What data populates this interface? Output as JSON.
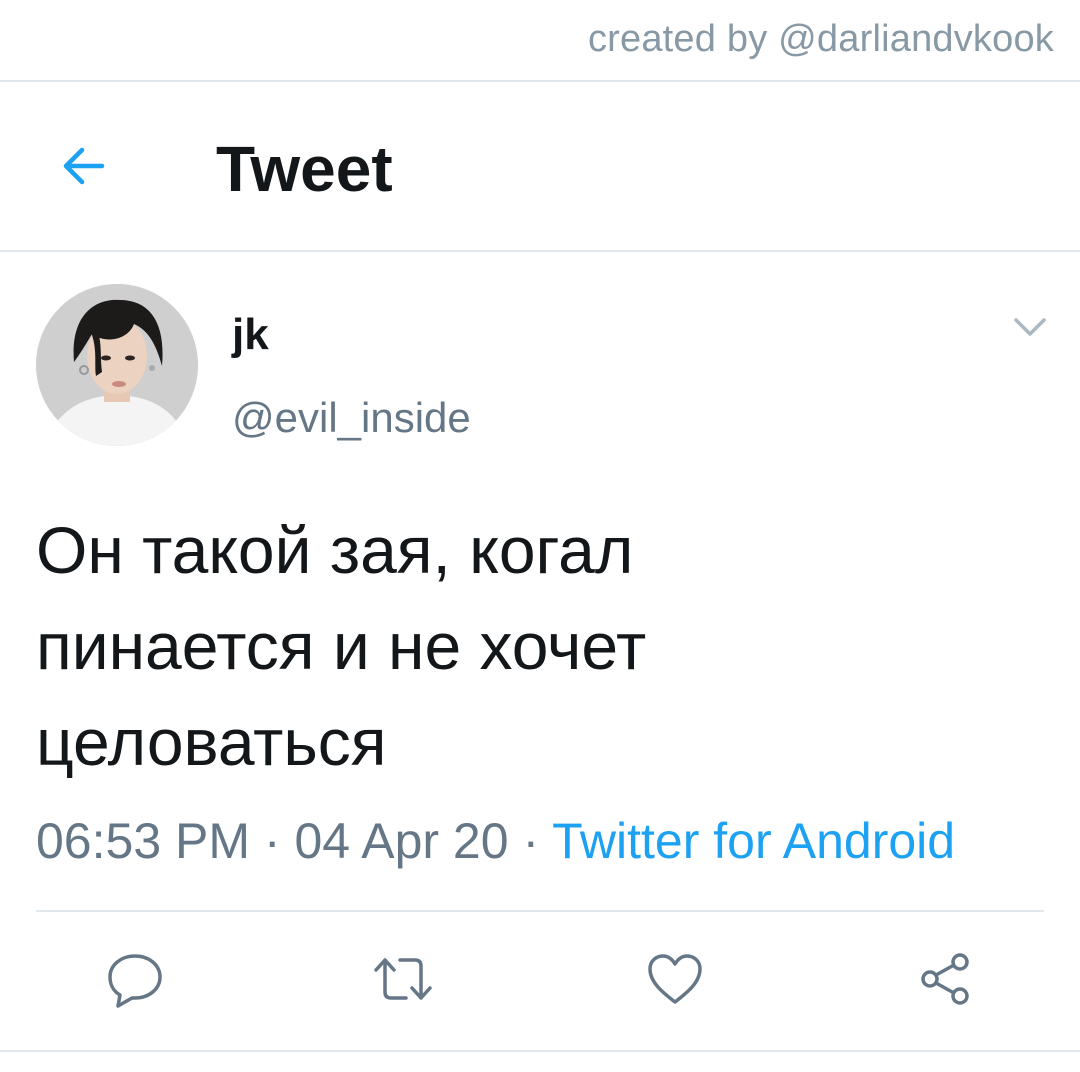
{
  "watermark": "created by @darliandvkook",
  "header": {
    "title": "Tweet",
    "back_icon": "arrow-left-icon",
    "accent_color": "#1da1f2"
  },
  "tweet": {
    "display_name": "jk",
    "handle": "@evil_inside",
    "text_lines": [
      "Он такой зая, когал",
      "пинается и не хочет",
      "целоваться"
    ],
    "time": "06:53 PM",
    "separator": "·",
    "date": "04 Apr 20",
    "source": "Twitter for Android",
    "menu_icon": "chevron-down-icon"
  },
  "actions": [
    {
      "icon": "reply-icon"
    },
    {
      "icon": "retweet-icon"
    },
    {
      "icon": "like-icon"
    },
    {
      "icon": "share-icon"
    }
  ],
  "colors": {
    "text": "#14171a",
    "secondary": "#657786",
    "link": "#1da1f2",
    "divider": "#e1e8ed"
  }
}
